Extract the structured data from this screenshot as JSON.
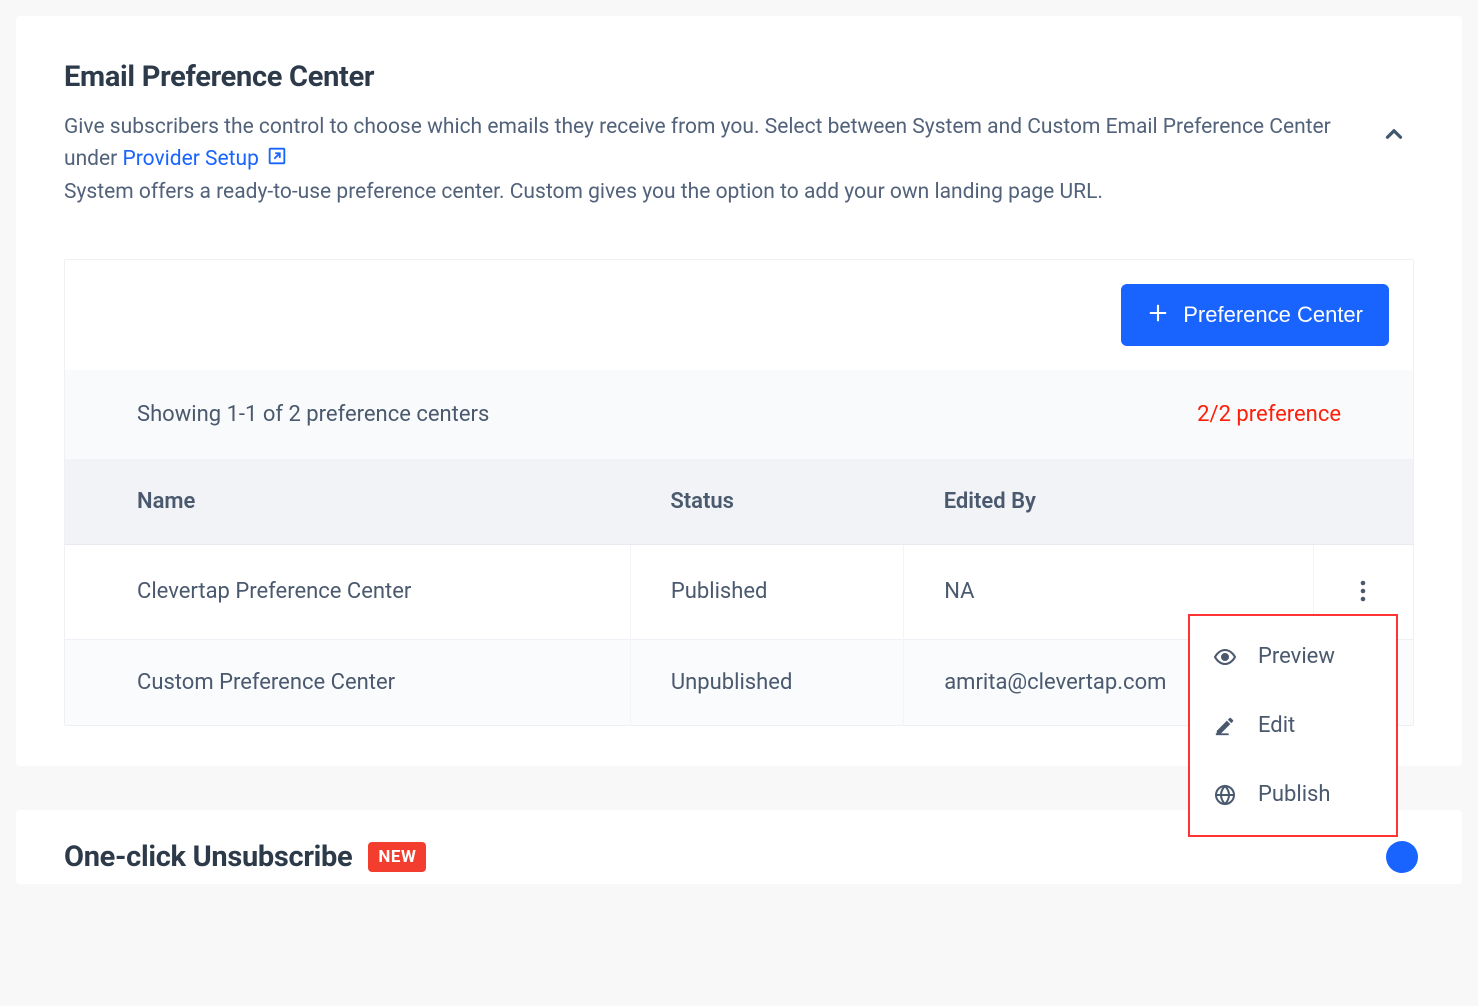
{
  "emailPrefCenter": {
    "title": "Email Preference Center",
    "descriptionPart1": "Give subscribers the control to choose which emails they receive from you. Select between System and Custom Email Preference Center under ",
    "providerSetupLink": "Provider Setup",
    "descriptionPart2": "System offers a ready-to-use preference center. Custom gives you the option to add your own landing page URL.",
    "addButtonLabel": "Preference Center",
    "showingText": "Showing 1-1 of 2 preference centers",
    "countBadge": "2/2 preference",
    "columns": {
      "name": "Name",
      "status": "Status",
      "editedBy": "Edited By"
    },
    "rows": [
      {
        "name": "Clevertap Preference Center",
        "status": "Published",
        "editedBy": "NA"
      },
      {
        "name": "Custom Preference Center",
        "status": "Unpublished",
        "editedBy": "amrita@clevertap.com"
      }
    ],
    "contextMenu": {
      "preview": "Preview",
      "edit": "Edit",
      "publish": "Publish"
    }
  },
  "oneClick": {
    "title": "One-click Unsubscribe",
    "badge": "NEW"
  }
}
